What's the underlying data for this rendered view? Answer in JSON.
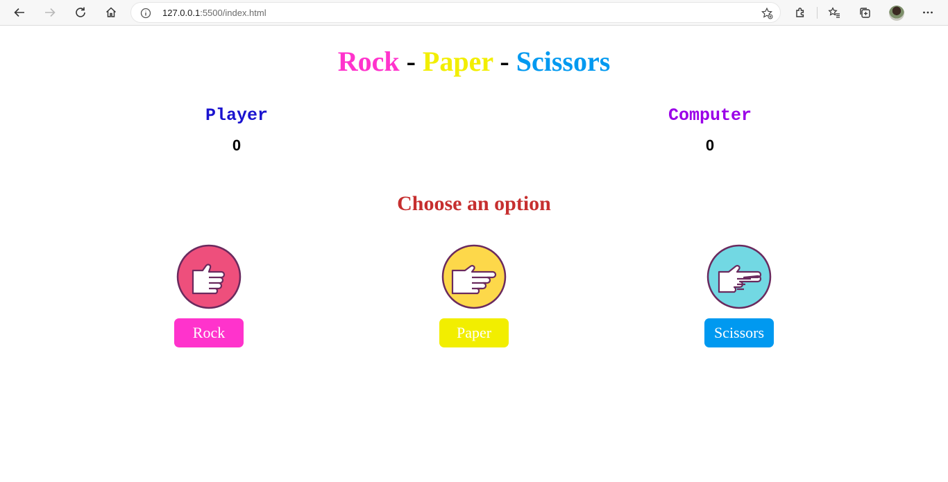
{
  "browser": {
    "url_host": "127.0.0.1",
    "url_path": ":5500/index.html"
  },
  "title": {
    "rock": "Rock",
    "sep1": "-",
    "paper": "Paper",
    "sep2": "-",
    "scissors": "Scissors"
  },
  "scores": {
    "player_label": "Player",
    "player_value": "0",
    "computer_label": "Computer",
    "computer_value": "0"
  },
  "prompt": "Choose an option",
  "options": [
    {
      "label": "Rock",
      "icon": "rock-fist-icon"
    },
    {
      "label": "Paper",
      "icon": "paper-hand-icon"
    },
    {
      "label": "Scissors",
      "icon": "scissors-hand-icon"
    }
  ],
  "colors": {
    "rock": "#ff33cc",
    "paper": "#f2ee00",
    "scissors": "#0099f0",
    "player": "#1a13cf",
    "computer": "#9b00e8",
    "prompt": "#c62f2f"
  }
}
